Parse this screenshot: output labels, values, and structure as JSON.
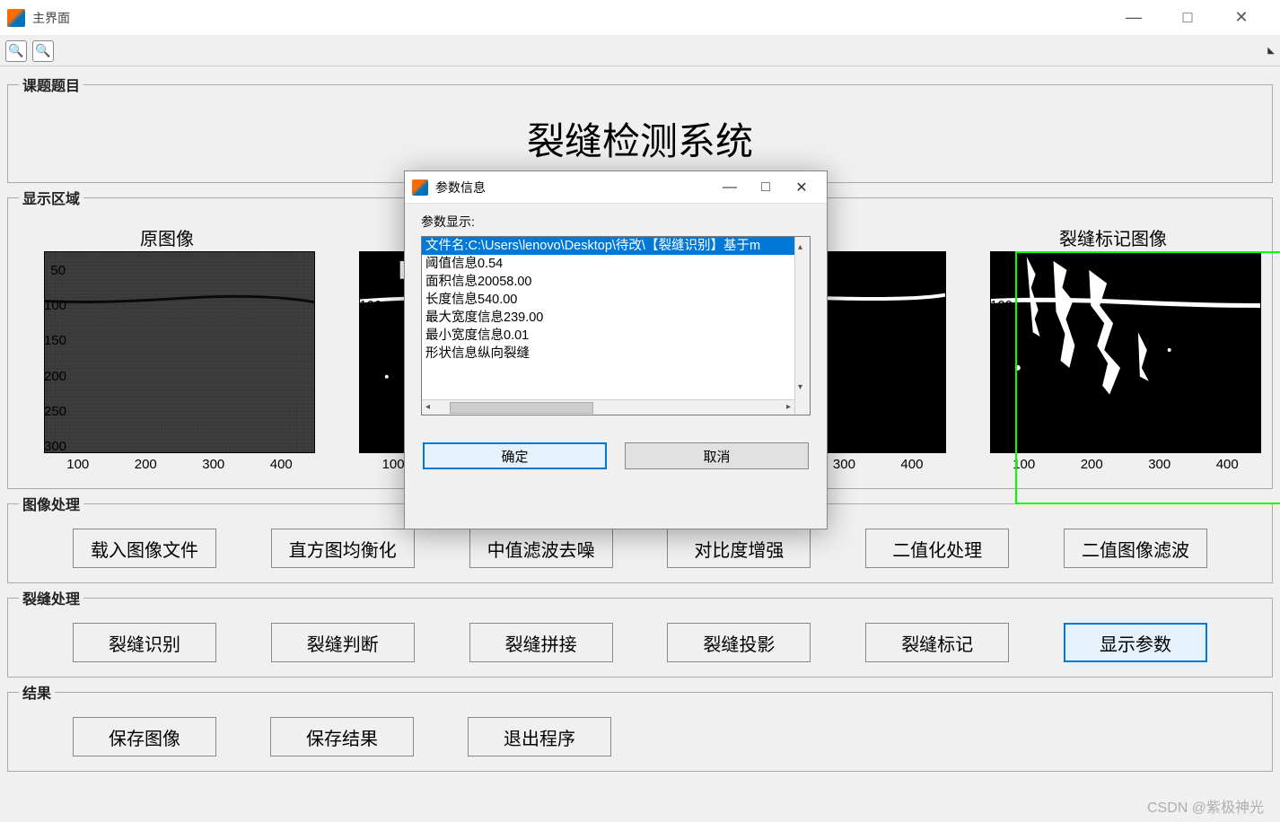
{
  "window": {
    "title": "主界面",
    "controls": {
      "min": "—",
      "max": "□",
      "close": "✕"
    }
  },
  "toolbar": {
    "zoom_in": "🔍+",
    "zoom_out": "🔍-"
  },
  "sections": {
    "topic_legend": "课题题目",
    "system_title": "裂缝检测系统",
    "display_legend": "显示区域",
    "image_proc_legend": "图像处理",
    "crack_proc_legend": "裂缝处理",
    "results_legend": "结果"
  },
  "axes": {
    "titles": [
      "原图像",
      "",
      "",
      "裂缝标记图像"
    ],
    "y_ticks": [
      "50",
      "100",
      "150",
      "200",
      "250",
      "300"
    ],
    "x_ticks": [
      "100",
      "200",
      "300",
      "400"
    ]
  },
  "buttons": {
    "image_proc": [
      "载入图像文件",
      "直方图均衡化",
      "中值滤波去噪",
      "对比度增强",
      "二值化处理",
      "二值图像滤波"
    ],
    "crack_proc": [
      "裂缝识别",
      "裂缝判断",
      "裂缝拼接",
      "裂缝投影",
      "裂缝标记",
      "显示参数"
    ],
    "results": [
      "保存图像",
      "保存结果",
      "退出程序"
    ]
  },
  "dialog": {
    "title": "参数信息",
    "label": "参数显示:",
    "items": [
      "文件名:C:\\Users\\lenovo\\Desktop\\待改\\【裂缝识别】基于m",
      "阈值信息0.54",
      "面积信息20058.00",
      "长度信息540.00",
      "最大宽度信息239.00",
      "最小宽度信息0.01",
      "形状信息纵向裂缝"
    ],
    "selected_index": 0,
    "ok": "确定",
    "cancel": "取消"
  },
  "watermark": "CSDN @紫极神光"
}
